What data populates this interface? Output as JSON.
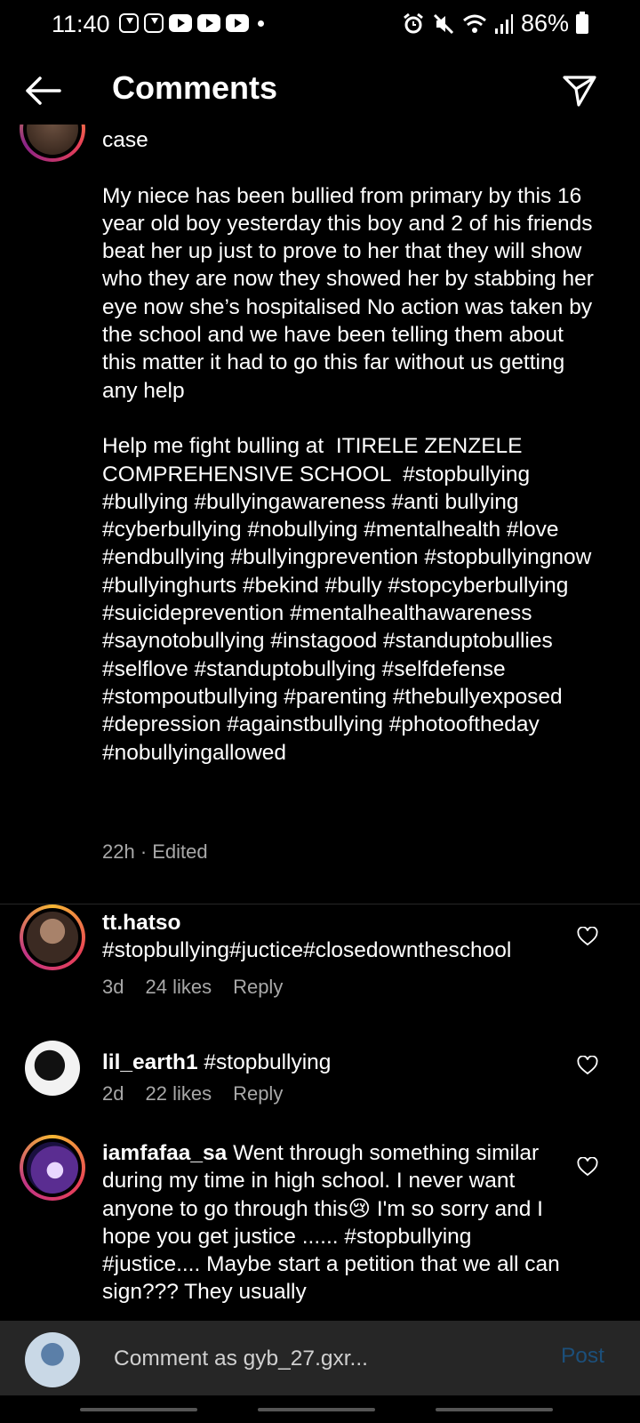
{
  "status_bar": {
    "time": "11:40",
    "battery": "86%",
    "notification_icons": [
      "download-icon",
      "download-icon",
      "youtube-icon",
      "youtube-icon",
      "youtube-icon",
      "dot-icon"
    ],
    "system_icons": [
      "alarm-icon",
      "mute-icon",
      "wifi-icon",
      "signal-icon",
      "battery-icon"
    ]
  },
  "header": {
    "title": "Comments"
  },
  "caption": {
    "text": "case\n\nMy niece has been bullied from primary by this 16 year old boy yesterday this boy and 2 of his friends beat her up just to prove to her that they will show who they are now they showed her by stabbing her eye now she’s hospitalised No action was taken by the school and we have been telling them about this matter it had to go this far without us getting any help\n\nHelp me fight bulling at  ITIRELE ZENZELE COMPREHENSIVE SCHOOL  #stopbullying #bullying #bullyingawareness #anti bullying #cyberbullying #nobullying #mentalhealth #love #endbullying #bullyingprevention #stopbullyingnow #bullyinghurts #bekind #bully #stopcyberbullying #suicideprevention #mentalhealthawareness #saynotobullying #instagood #standuptobullies #selflove #standuptobullying #selfdefense #stompoutbullying #parenting #thebullyexposed #depression #againstbullying #photooftheday #nobullyingallowed",
    "meta": "22h · Edited"
  },
  "comments": [
    {
      "username": "tt.hatso",
      "text": "#stopbullying#juctice#closedowntheschool",
      "time": "3d",
      "likes": "24 likes",
      "reply": "Reply"
    },
    {
      "username": "lil_earth1",
      "text": "#stopbullying",
      "time": "2d",
      "likes": "22 likes",
      "reply": "Reply"
    },
    {
      "username": "iamfafaa_sa",
      "text": "Went through something similar during my time in high school. I never want anyone to go through this😢 I'm so sorry and I hope you get justice ...... #stopbullying #justice.... Maybe start a petition that we all can sign??? They usually"
    }
  ],
  "comment_bar": {
    "placeholder": "Comment as gyb_27.gxr...",
    "post_label": "Post"
  },
  "colors": {
    "background": "#000000",
    "secondary_text": "#a8a8a8",
    "post_disabled": "#1c4f7a",
    "input_bar": "#262626"
  }
}
